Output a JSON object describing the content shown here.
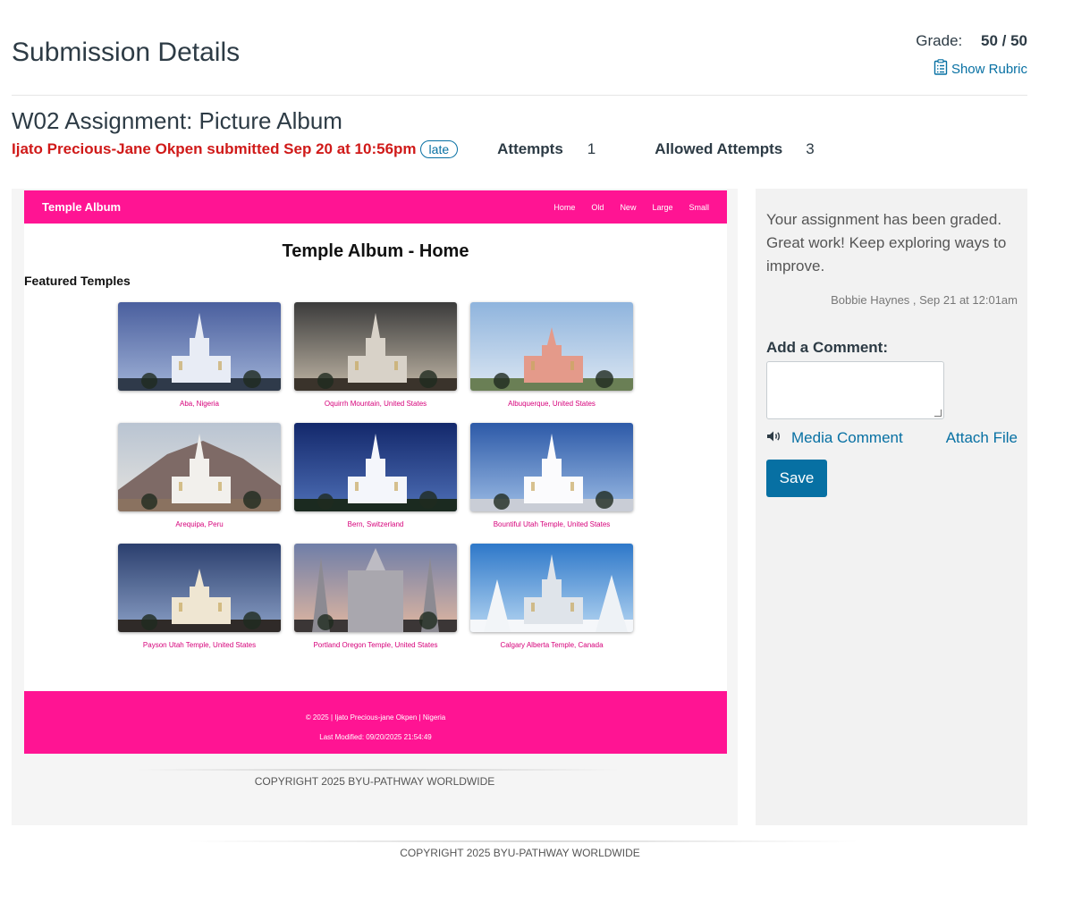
{
  "header": {
    "title": "Submission Details",
    "grade_label": "Grade:",
    "grade_value": "50 / 50",
    "show_rubric": "Show Rubric"
  },
  "assignment": {
    "title": "W02 Assignment: Picture Album",
    "submitted_text": "Ijato Precious-Jane Okpen submitted Sep 20 at 10:56pm",
    "late_badge": "late",
    "attempts_label": "Attempts",
    "attempts_value": "1",
    "allowed_label": "Allowed Attempts",
    "allowed_value": "3"
  },
  "student_page": {
    "brand": "Temple Album",
    "nav": [
      "Home",
      "Old",
      "New",
      "Large",
      "Small"
    ],
    "heading": "Temple Album - Home",
    "subheading": "Featured Temples",
    "temples": [
      {
        "caption": "Aba, Nigeria",
        "scene": "dusk"
      },
      {
        "caption": "Oquirrh Mountain, United States",
        "scene": "stormy"
      },
      {
        "caption": "Albuquerque, United States",
        "scene": "pink"
      },
      {
        "caption": "Arequipa, Peru",
        "scene": "volcano"
      },
      {
        "caption": "Bern, Switzerland",
        "scene": "night"
      },
      {
        "caption": "Bountiful Utah Temple, United States",
        "scene": "bluesky"
      },
      {
        "caption": "Payson Utah Temple, United States",
        "scene": "dusk2"
      },
      {
        "caption": "Portland Oregon Temple, United States",
        "scene": "spires"
      },
      {
        "caption": "Calgary Alberta Temple, Canada",
        "scene": "snow"
      }
    ],
    "footer_line1": "© 2025 | Ijato Precious-jane Okpen | Nigeria",
    "footer_line2": "Last Modified: 09/20/2025 21:54:49",
    "accent_color": "#ff1493"
  },
  "preview_copyright": "COPYRIGHT 2025 BYU-PATHWAY WORLDWIDE",
  "sidebar": {
    "comment": "Your assignment has been graded. Great work! Keep exploring ways to improve.",
    "comment_meta": "Bobbie Haynes , Sep 21 at 12:01am",
    "add_comment_label": "Add a Comment:",
    "media_comment": "Media Comment",
    "attach_file": "Attach File",
    "save": "Save"
  },
  "page_copyright": "COPYRIGHT 2025 BYU-PATHWAY WORLDWIDE",
  "colors": {
    "link": "#0770a3",
    "late_red": "#d01a19",
    "save_button": "#0770a3"
  }
}
